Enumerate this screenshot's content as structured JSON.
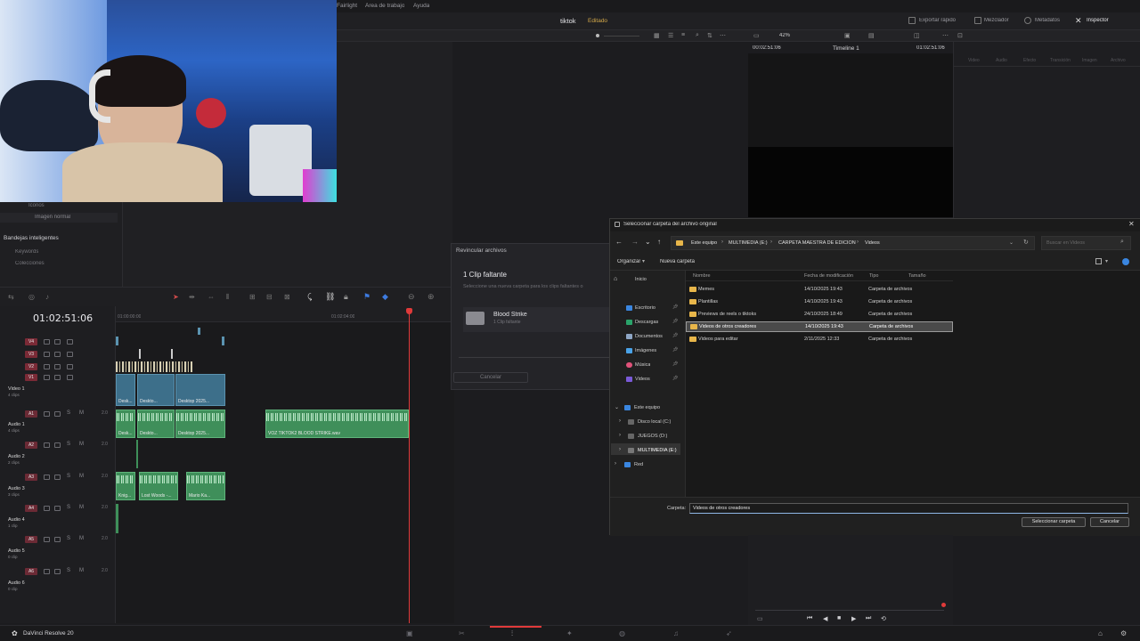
{
  "menu": {
    "items": [
      "Fairlight",
      "Área de trabajo",
      "Ayuda"
    ]
  },
  "titlebar": {
    "project": "tiktok",
    "status": "Editado",
    "right_buttons": [
      "Exportar rápido",
      "Mezclador",
      "Metadatos",
      "Inspector"
    ]
  },
  "viewer_bar": {
    "zoom": "42%",
    "timecode_left": "00:02:51:06",
    "timeline_name": "Timeline 1",
    "timecode_right": "01:02:51:06"
  },
  "inspector_tabs": [
    "Video",
    "Audio",
    "Efecto",
    "Transición",
    "Imagen",
    "Archivo"
  ],
  "bins": {
    "items": [
      "Iconos",
      "Imagen normal"
    ],
    "smart_bins_title": "Bandejas inteligentes",
    "smart_bins": [
      "Keywords",
      "Colecciones"
    ]
  },
  "timeline": {
    "timecode": "01:02:51:06",
    "ruler": [
      "01:00:00:00",
      "01:02:04:00"
    ],
    "tracks": [
      {
        "id": "V4",
        "kind": "video"
      },
      {
        "id": "V3",
        "kind": "video"
      },
      {
        "id": "V2",
        "kind": "video"
      },
      {
        "id": "V1",
        "kind": "video",
        "name": "Video 1",
        "sub": "4 clips"
      },
      {
        "id": "A1",
        "kind": "audio",
        "name": "Audio 1",
        "sub": "4 clips",
        "vol": "2.0"
      },
      {
        "id": "A2",
        "kind": "audio",
        "name": "Audio 2",
        "sub": "2 clips",
        "vol": "2.0"
      },
      {
        "id": "A3",
        "kind": "audio",
        "name": "Audio 3",
        "sub": "3 clips",
        "vol": "2.0"
      },
      {
        "id": "A4",
        "kind": "audio",
        "name": "Audio 4",
        "sub": "1 clip",
        "vol": "2.0"
      },
      {
        "id": "A5",
        "kind": "audio",
        "name": "Audio 5",
        "sub": "0 clip",
        "vol": "2.0"
      },
      {
        "id": "A6",
        "kind": "audio",
        "name": "Audio 6",
        "sub": "0 clip",
        "vol": "2.0"
      }
    ],
    "clips": {
      "v1": [
        "Desk...",
        "Deskto...",
        "Desktop 2025..."
      ],
      "a1": [
        "Desk...",
        "Deskto...",
        "Desktop 2025...",
        "VOZ TIKTOK2 BLOOD STRIKE.wav"
      ],
      "a3": [
        "Knig...",
        "Lost Woods -...",
        "Mario Ka..."
      ]
    }
  },
  "relink": {
    "title": "Revincular archivos",
    "heading": "1 Clip faltante",
    "desc": "Seleccione una nueva carpeta para los clips faltantes o",
    "folder_name": "Blood Strike",
    "folder_sub": "1 Clip faltante",
    "cancel": "Cancelar"
  },
  "file_dialog": {
    "title": "Seleccionar carpeta del archivo original",
    "breadcrumb": [
      "Este equipo",
      "MULTIMEDIA (E:)",
      "CARPETA MAESTRA DE EDICION",
      "Videos"
    ],
    "search_placeholder": "Buscar en Videos",
    "organize": "Organizar",
    "new_folder": "Nueva carpeta",
    "columns": [
      "Nombre",
      "Fecha de modificación",
      "Tipo",
      "Tamaño"
    ],
    "nav": {
      "home": "Inicio",
      "quick": [
        "Escritorio",
        "Descargas",
        "Documentos",
        "Imágenes",
        "Música",
        "Videos"
      ],
      "this_pc": "Este equipo",
      "drives": [
        "Disco local (C:)",
        "JUEGOS (D:)",
        "MULTIMEDIA (E:)"
      ],
      "network": "Red"
    },
    "rows": [
      {
        "name": "Memes",
        "date": "14/10/2025 19:43",
        "type": "Carpeta de archivos"
      },
      {
        "name": "Plantillas",
        "date": "14/10/2025 19:43",
        "type": "Carpeta de archivos"
      },
      {
        "name": "Previews de reels o tiktoks",
        "date": "24/10/2025 18:49",
        "type": "Carpeta de archivos"
      },
      {
        "name": "Videos de otros creadores",
        "date": "14/10/2025 19:43",
        "type": "Carpeta de archivos"
      },
      {
        "name": "Videos para editar",
        "date": "2/11/2025 12:33",
        "type": "Carpeta de archivos"
      }
    ],
    "folder_label": "Carpeta:",
    "folder_value": "Videos de otros creadores",
    "select_button": "Seleccionar carpeta",
    "cancel_button": "Cancelar"
  },
  "statusbar": {
    "app": "DaVinci Resolve 20"
  },
  "colors": {
    "accent_red": "#e03a3a",
    "audio_clip": "#3f8f5a",
    "video_clip": "#3d6f8a",
    "selection": "#cce4f7"
  }
}
